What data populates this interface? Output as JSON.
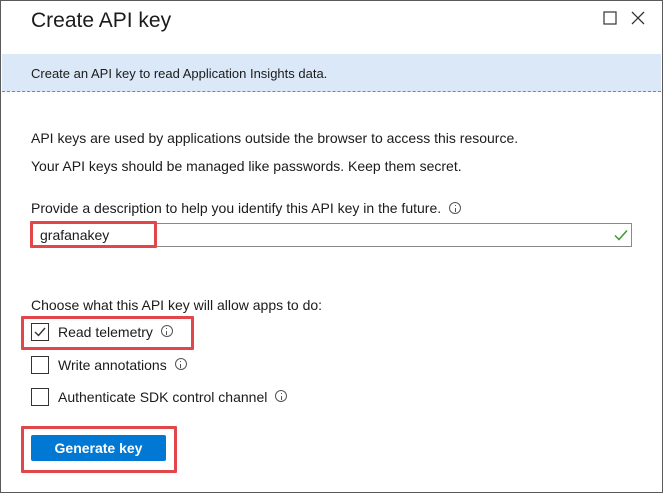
{
  "dialog": {
    "title": "Create API key",
    "banner": "Create an API key to read Application Insights data."
  },
  "intro": {
    "line1": "API keys are used by applications outside the browser to access this resource.",
    "line2": "Your API keys should be managed like passwords. Keep them secret."
  },
  "description": {
    "label": "Provide a description to help you identify this API key in the future.",
    "value": "grafanakey"
  },
  "permissions": {
    "label": "Choose what this API key will allow apps to do:",
    "options": [
      {
        "label": "Read telemetry",
        "checked": true
      },
      {
        "label": "Write annotations",
        "checked": false
      },
      {
        "label": "Authenticate SDK control channel",
        "checked": false
      }
    ]
  },
  "actions": {
    "generate_label": "Generate key"
  },
  "colors": {
    "accent": "#0078d4",
    "banner": "#dbe8f7",
    "highlight": "#e0464a",
    "valid": "#3a9a2f"
  },
  "icons": {
    "maximize": "maximize-icon",
    "close": "close-icon",
    "info": "info-icon",
    "valid": "checkmark-icon"
  }
}
